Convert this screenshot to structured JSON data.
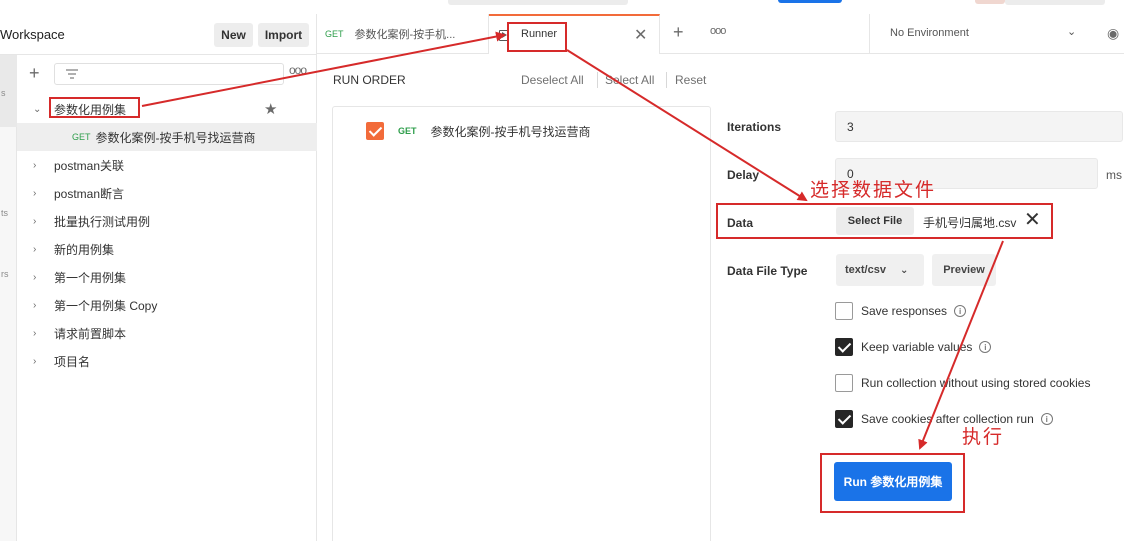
{
  "sidebar": {
    "workspace_title": "Workspace",
    "new_label": "New",
    "import_label": "Import",
    "rail": [
      "s",
      "ts",
      "rs"
    ],
    "collections": [
      {
        "label": "参数化用例集",
        "expanded": true
      },
      {
        "label": "postman关联"
      },
      {
        "label": "postman断言"
      },
      {
        "label": "批量执行测试用例"
      },
      {
        "label": "新的用例集"
      },
      {
        "label": "第一个用例集"
      },
      {
        "label": "第一个用例集 Copy"
      },
      {
        "label": "请求前置脚本"
      },
      {
        "label": "项目名"
      }
    ],
    "request": {
      "method": "GET",
      "label": "参数化案例-按手机号找运营商"
    }
  },
  "tabs": {
    "request_tab": {
      "method": "GET",
      "label": "参数化案例-按手机..."
    },
    "runner_tab": {
      "label": "Runner"
    },
    "environment": "No Environment"
  },
  "run_order": {
    "title": "RUN ORDER",
    "deselect_all": "Deselect All",
    "select_all": "Select All",
    "reset": "Reset",
    "items": [
      {
        "method": "GET",
        "label": "参数化案例-按手机号找运营商",
        "checked": true
      }
    ]
  },
  "settings": {
    "iterations_label": "Iterations",
    "iterations_value": "3",
    "delay_label": "Delay",
    "delay_value": "0",
    "delay_unit": "ms",
    "data_label": "Data",
    "select_file": "Select File",
    "file_name": "手机号归属地.csv",
    "data_file_type_label": "Data File Type",
    "data_file_type": "text/csv",
    "preview": "Preview",
    "options": [
      {
        "label": "Save responses",
        "checked": false
      },
      {
        "label": "Keep variable values",
        "checked": true
      },
      {
        "label": "Run collection without using stored cookies",
        "checked": false
      },
      {
        "label": "Save cookies after collection run",
        "checked": true
      }
    ],
    "run_button": "Run 参数化用例集"
  },
  "annotations": {
    "select_data_file": "选择数据文件",
    "execute": "执行",
    "color": "#d62a2a"
  },
  "colors": {
    "accent": "#f26b3a",
    "run_button": "#1a73e8",
    "get_method": "#2e9e4b"
  }
}
